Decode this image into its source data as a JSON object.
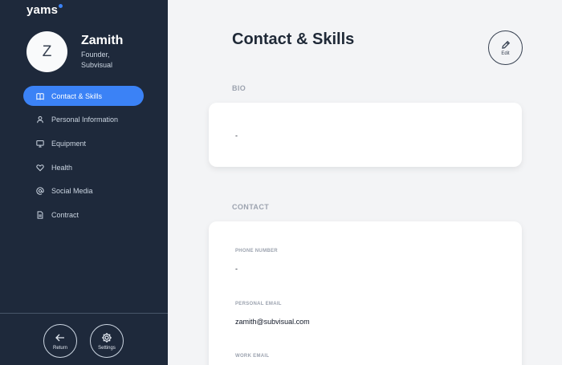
{
  "sidebar": {
    "logo": "yams",
    "avatar_initial": "Z",
    "user_name": "Zamith",
    "user_role": "Founder, Subvisual",
    "nav_items": [
      {
        "label": "Contact & Skills",
        "icon": "book-icon",
        "active": true
      },
      {
        "label": "Personal Information",
        "icon": "user-icon",
        "active": false
      },
      {
        "label": "Equipment",
        "icon": "monitor-icon",
        "active": false
      },
      {
        "label": "Health",
        "icon": "heart-icon",
        "active": false
      },
      {
        "label": "Social Media",
        "icon": "at-icon",
        "active": false
      },
      {
        "label": "Contract",
        "icon": "document-icon",
        "active": false
      }
    ],
    "return_label": "Return",
    "settings_label": "Settings"
  },
  "main": {
    "title": "Contact & Skills",
    "edit_label": "Edit",
    "bio": {
      "section_label": "BIO",
      "value": "-"
    },
    "contact": {
      "section_label": "CONTACT",
      "fields": [
        {
          "label": "PHONE NUMBER",
          "value": "-"
        },
        {
          "label": "PERSONAL EMAIL",
          "value": "zamith@subvisual.com"
        },
        {
          "label": "WORK EMAIL",
          "value": ""
        }
      ]
    }
  },
  "colors": {
    "sidebar_bg": "#1e293b",
    "accent": "#3b82f6",
    "page_bg": "#f3f4f6"
  }
}
